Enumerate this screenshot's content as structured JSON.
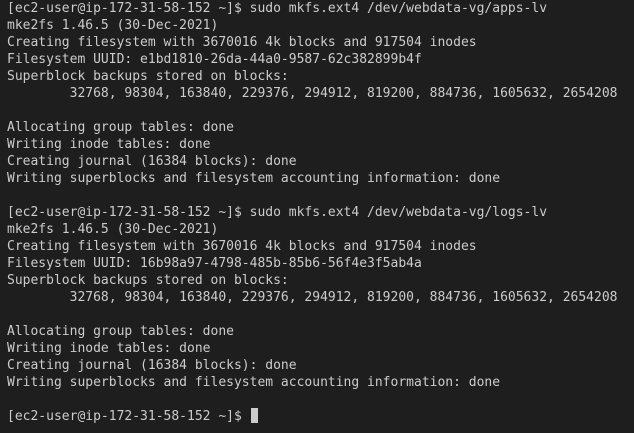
{
  "terminal": {
    "colors": {
      "background": "#1e1e1e",
      "text": "#cccccc",
      "cursor": "#cccccc"
    },
    "lines": [
      "[ec2-user@ip-172-31-58-152 ~]$ sudo mkfs.ext4 /dev/webdata-vg/apps-lv",
      "mke2fs 1.46.5 (30-Dec-2021)",
      "Creating filesystem with 3670016 4k blocks and 917504 inodes",
      "Filesystem UUID: e1bd1810-26da-44a0-9587-62c382899b4f",
      "Superblock backups stored on blocks:",
      "        32768, 98304, 163840, 229376, 294912, 819200, 884736, 1605632, 2654208",
      "",
      "Allocating group tables: done",
      "Writing inode tables: done",
      "Creating journal (16384 blocks): done",
      "Writing superblocks and filesystem accounting information: done",
      "",
      "[ec2-user@ip-172-31-58-152 ~]$ sudo mkfs.ext4 /dev/webdata-vg/logs-lv",
      "mke2fs 1.46.5 (30-Dec-2021)",
      "Creating filesystem with 3670016 4k blocks and 917504 inodes",
      "Filesystem UUID: 16b98a97-4798-485b-85b6-56f4e3f5ab4a",
      "Superblock backups stored on blocks:",
      "        32768, 98304, 163840, 229376, 294912, 819200, 884736, 1605632, 2654208",
      "",
      "Allocating group tables: done",
      "Writing inode tables: done",
      "Creating journal (16384 blocks): done",
      "Writing superblocks and filesystem accounting information: done",
      "",
      "[ec2-user@ip-172-31-58-152 ~]$ "
    ]
  }
}
